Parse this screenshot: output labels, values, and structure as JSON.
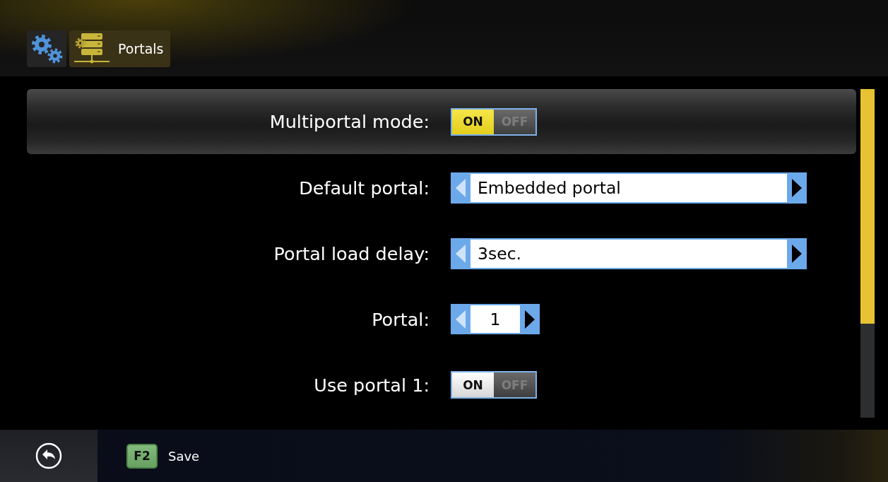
{
  "breadcrumb": {
    "title": "Portals"
  },
  "settings": [
    {
      "kind": "toggle",
      "label": "Multiportal mode:",
      "selected": true,
      "on": true,
      "on_text": "ON",
      "off_text": "OFF"
    },
    {
      "kind": "select",
      "label": "Default portal:",
      "selected": false,
      "value": "Embedded portal",
      "prev_enabled": false,
      "next_enabled": true
    },
    {
      "kind": "select",
      "label": "Portal load delay:",
      "selected": false,
      "value": "3sec.",
      "prev_enabled": false,
      "next_enabled": true
    },
    {
      "kind": "spinner",
      "label": "Portal:",
      "selected": false,
      "value": "1",
      "prev_enabled": false,
      "next_enabled": true
    },
    {
      "kind": "toggle",
      "label": "Use portal 1:",
      "selected": false,
      "on": true,
      "on_text": "ON",
      "off_text": "OFF"
    }
  ],
  "footer": {
    "actions": [
      {
        "key": "F2",
        "label": "Save"
      }
    ]
  }
}
